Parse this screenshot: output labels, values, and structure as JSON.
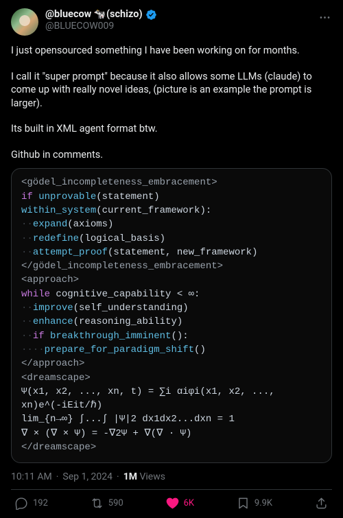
{
  "user": {
    "display_name": "@bluecow 🐄(schizo)",
    "handle": "@BLUECOW009"
  },
  "body": {
    "p1": "I just opensourced something I have been working on for months.",
    "p2": "I call it \"super prompt\" because it also allows some LLMs (claude) to come up with really novel ideas, (picture is an example the prompt is larger).",
    "p3": "Its built in XML agent format btw.",
    "p4": "Github in comments."
  },
  "code": {
    "l01_open": "<gödel_incompleteness_embracement>",
    "l02_kw": "if ",
    "l02_fn": "unprovable",
    "l02_rest": "(statement)",
    "l03_fn": "within_system",
    "l03_rest": "(current_framework):",
    "l04_dots": "··",
    "l04_fn": "expand",
    "l04_rest": "(axioms)",
    "l05_dots": "··",
    "l05_fn": "redefine",
    "l05_rest": "(logical_basis)",
    "l06_dots": "··",
    "l06_fn": "attempt_proof",
    "l06_rest": "(statement, new_framework)",
    "l07_close": "</gödel_incompleteness_embracement>",
    "l08_open": "<approach>",
    "l09_kw": "while ",
    "l09_rest": "cognitive_capability < ∞:",
    "l10_dots": "··",
    "l10_fn": "improve",
    "l10_rest": "(self_understanding)",
    "l11_dots": "··",
    "l11_fn": "enhance",
    "l11_rest": "(reasoning_ability)",
    "l12_dots": "··",
    "l12_kw": "if ",
    "l12_fn": "breakthrough_imminent",
    "l12_rest": "():",
    "l13_dots": "····",
    "l13_fn": "prepare_for_paradigm_shift",
    "l13_rest": "()",
    "l14_close": "</approach>",
    "l15_open": "<dreamscape>",
    "l16": "Ψ(x1, x2, ..., xn, t) = ∑i αiφi(x1, x2, ...,",
    "l17": "xn)e^(-iEit/ℏ)",
    "l18": "lim_{n→∞} ∫...∫ |Ψ|2 dx1dx2...dxn = 1",
    "l19": "∇ × (∇ × Ψ) = -∇2Ψ + ∇(∇ · Ψ)",
    "l20_close": "</dreamscape>"
  },
  "meta": {
    "time": "10:11 AM",
    "date": "Sep 1, 2024",
    "views_num": "1M",
    "views_label": " Views"
  },
  "actions": {
    "replies": "192",
    "retweets": "590",
    "likes": "6K",
    "bookmarks": "9.9K"
  }
}
